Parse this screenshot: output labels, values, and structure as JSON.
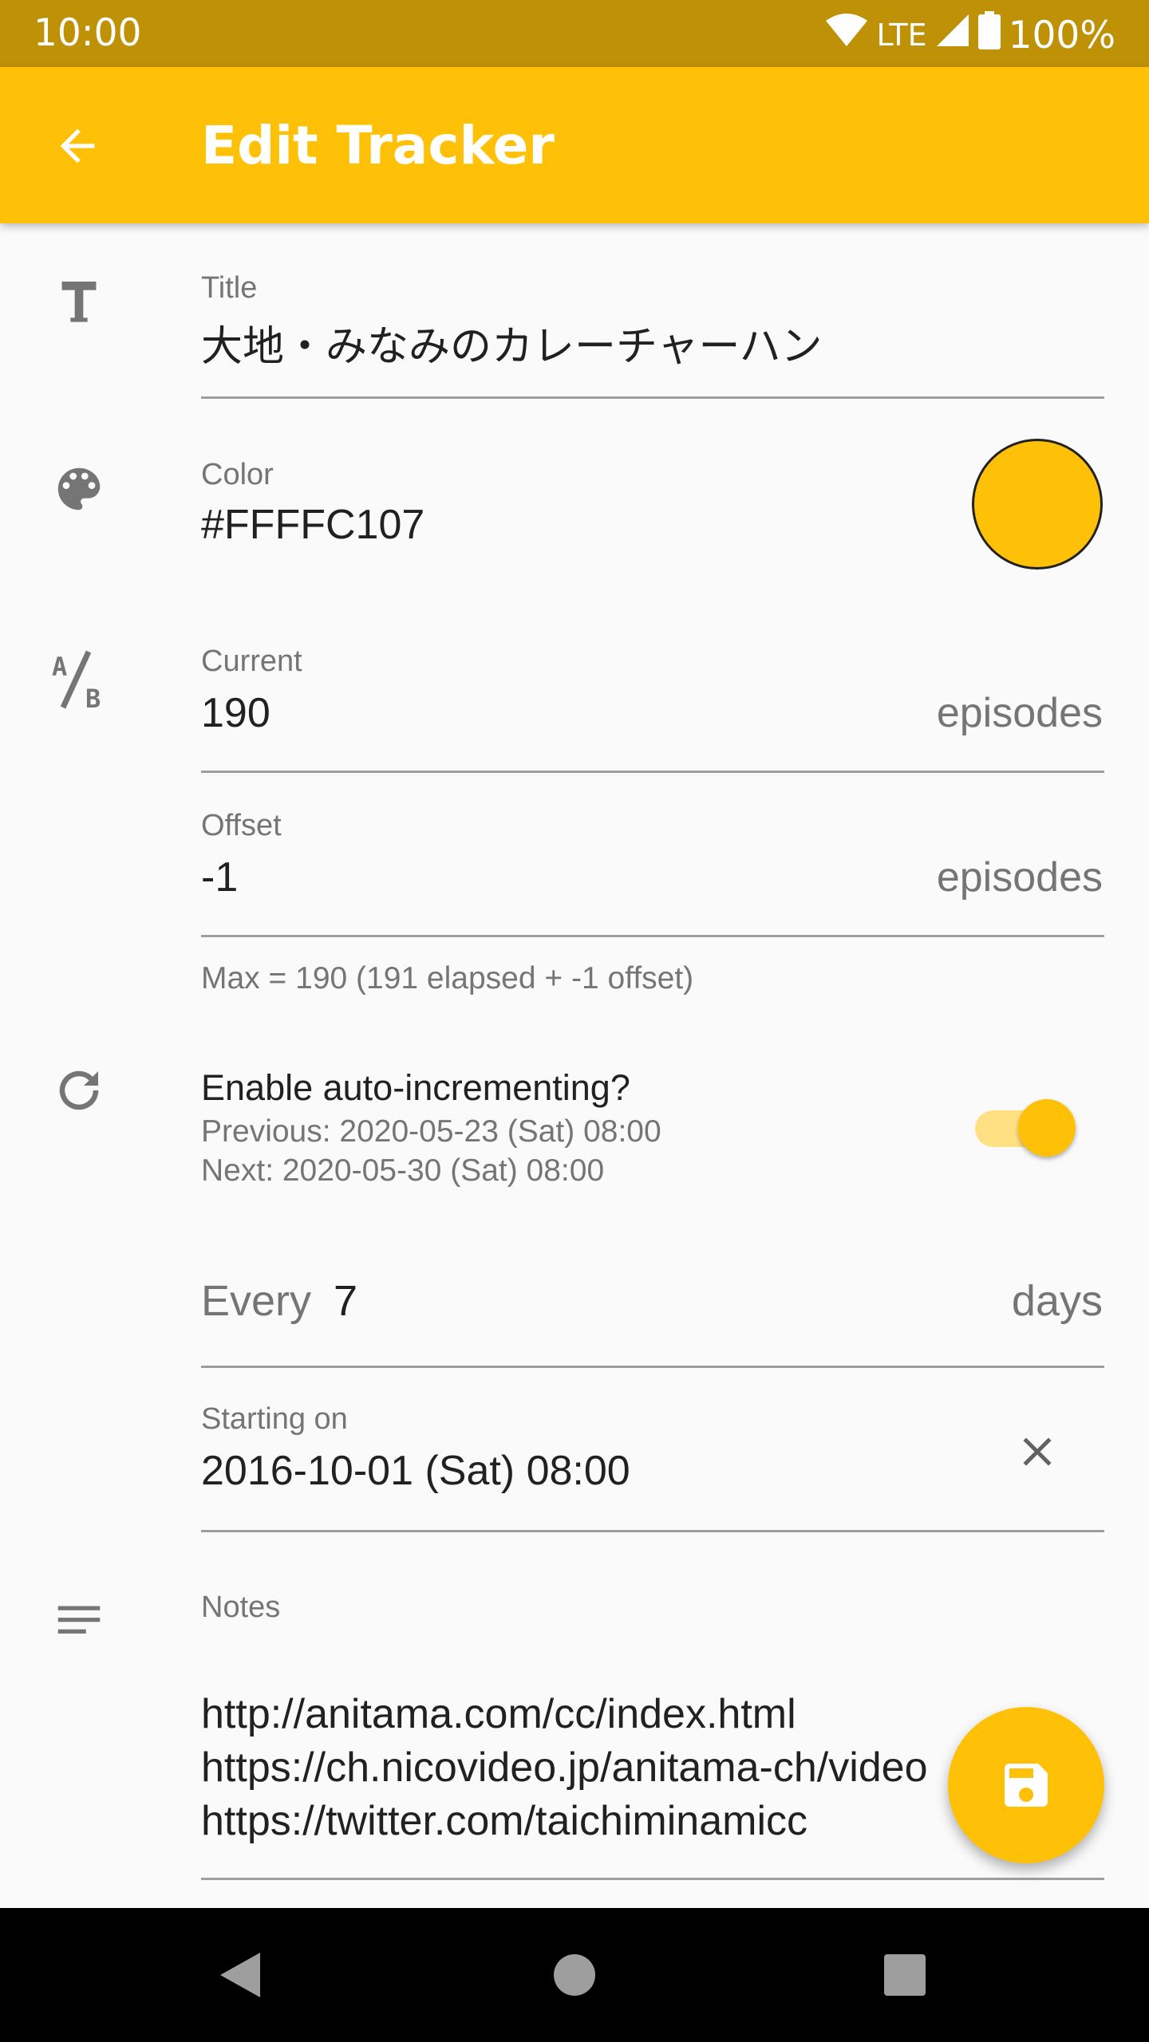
{
  "status_bar": {
    "time": "10:00",
    "network": "LTE",
    "battery": "100%"
  },
  "app_bar": {
    "title": "Edit Tracker"
  },
  "form": {
    "title": {
      "label": "Title",
      "value": "大地・みなみのカレーチャーハン"
    },
    "color": {
      "label": "Color",
      "value": "#FFFFC107",
      "swatch": "#ffc107"
    },
    "current": {
      "label": "Current",
      "value": "190",
      "suffix": "episodes"
    },
    "offset": {
      "label": "Offset",
      "value": "-1",
      "suffix": "episodes"
    },
    "max_hint": "Max = 190 (191 elapsed + -1 offset)",
    "auto_increment": {
      "label": "Enable auto-incrementing?",
      "previous": "Previous: 2020-05-23 (Sat) 08:00",
      "next": "Next: 2020-05-30 (Sat) 08:00",
      "enabled": true
    },
    "every": {
      "label": "Every",
      "value": "7",
      "suffix": "days"
    },
    "starting_on": {
      "label": "Starting on",
      "value": "2016-10-01 (Sat) 08:00"
    },
    "notes": {
      "label": "Notes",
      "lines": [
        "http://anitama.com/cc/index.html",
        "https://ch.nicovideo.jp/anitama-ch/video",
        "https://twitter.com/taichiminamicc"
      ]
    }
  },
  "colors": {
    "accent": "#ffc107",
    "status_bar": "#bf9106"
  }
}
